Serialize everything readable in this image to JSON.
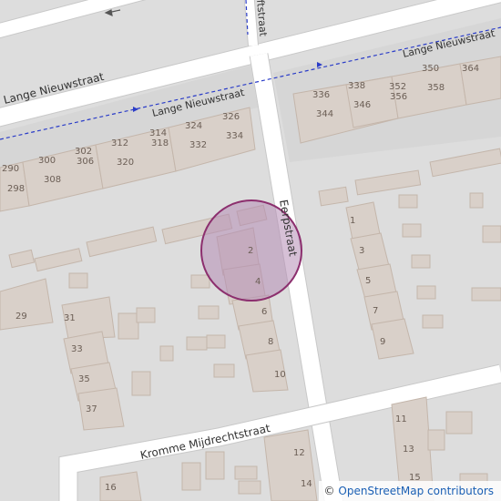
{
  "streets": {
    "lange_nieuwstraat_main": "Lange Nieuwstraat",
    "lange_nieuwstraat_right": "Lange Nieuwstraat",
    "lange_nieuwstraat_upper": "Lange Nieuwstraat",
    "eerpstraat": "Eerpstraat",
    "kromme_mijdrechtstraat": "Kromme Mijdrechtstraat",
    "partial_top": "ftstraat"
  },
  "house_numbers": {
    "h290": "290",
    "h298": "298",
    "h300": "300",
    "h308": "308",
    "h302": "302",
    "h306": "306",
    "h312": "312",
    "h320": "320",
    "h314": "314",
    "h318": "318",
    "h324": "324",
    "h332": "332",
    "h326": "326",
    "h334": "334",
    "h336": "336",
    "h338": "338",
    "h344": "344",
    "h346": "346",
    "h352": "352",
    "h356": "356",
    "h350": "350",
    "h358": "358",
    "h364": "364",
    "e2": "2",
    "e4": "4",
    "e6": "6",
    "e8": "8",
    "e10": "10",
    "r1": "1",
    "r3": "3",
    "r5": "5",
    "r7": "7",
    "r9": "9",
    "w29": "29",
    "w31": "31",
    "w33": "33",
    "w35": "35",
    "w37": "37",
    "k11": "11",
    "k13": "13",
    "k15": "15",
    "k12": "12",
    "k14": "14",
    "k16": "16"
  },
  "attribution": {
    "copyright": "©",
    "text": "OpenStreetMap contributors"
  },
  "marker": {
    "fill": "#b48cb4",
    "stroke": "#8c2f6e"
  },
  "colors": {
    "background": "#dddddd",
    "road": "#ffffff",
    "building": "#d9d0c9",
    "building_outline": "#c4b6ab",
    "boundary": "#2a3cc8"
  }
}
